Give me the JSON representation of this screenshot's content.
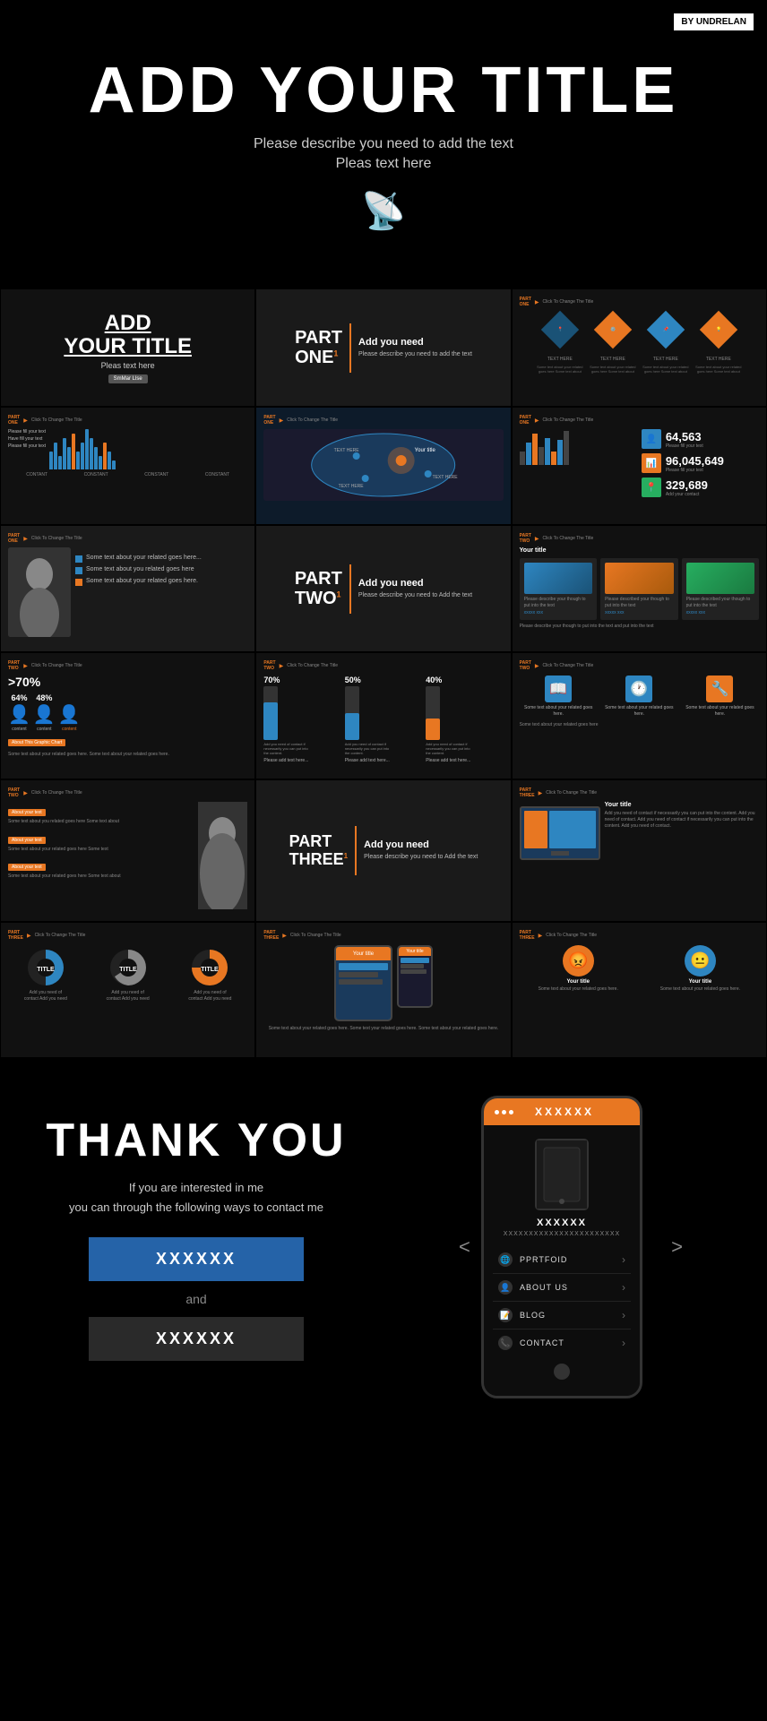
{
  "watermark": {
    "text": "BY UNDRELAN"
  },
  "hero": {
    "title": "ADD YOUR TITLE",
    "subtitle1": "Please describe you need to add the text",
    "subtitle2": "Pleas text here"
  },
  "slides": {
    "row1": [
      {
        "type": "title",
        "title_line1": "ADD",
        "title_line2": "YOUR TITLE",
        "subtitle": "Pleas text here",
        "button": "SmMar Llse"
      },
      {
        "type": "part-intro",
        "part": "PART",
        "number": "ONE",
        "superscript": "1",
        "add_text": "Add you need",
        "desc": "Please describe you need to add the text"
      },
      {
        "type": "diamonds",
        "part": "PART ONE",
        "click": "Click To Change The Title",
        "items": [
          {
            "label": "TEXT HERE",
            "color": "blue"
          },
          {
            "label": "TEXT HERE",
            "color": "orange"
          },
          {
            "label": "TEXT HERE",
            "color": "blue2"
          },
          {
            "label": "TEXT HERE",
            "color": "orange"
          }
        ]
      }
    ],
    "row2": [
      {
        "type": "waveform",
        "part": "PART ONE",
        "click": "Click To Change The Title",
        "labels": [
          "CONTANT",
          "CONSTANT",
          "CONSTANT",
          "CONSTANT"
        ]
      },
      {
        "type": "map",
        "part": "PART ONE",
        "click": "Click To Change The Title",
        "labels": [
          "TEXT HERE",
          "Your title",
          "TEXT HERE",
          "TEXT HERE"
        ]
      },
      {
        "type": "stats",
        "part": "PART ONE",
        "click": "Click To Change The Title",
        "stats": [
          {
            "number": "64,563",
            "label": "Please fill your text"
          },
          {
            "number": "96,045,649",
            "label": "Please fill your text"
          },
          {
            "number": "329,689",
            "label": "Add your contact"
          }
        ]
      }
    ],
    "row3": [
      {
        "type": "photo-bullets",
        "part": "PART ONE",
        "click": "Click To Change The Title",
        "bullets": [
          "Some text about your related goes here...",
          "Some text about you related goes here",
          "Some text about your related goes here."
        ]
      },
      {
        "type": "part-intro",
        "part": "PART",
        "number": "TWO",
        "superscript": "1",
        "add_text": "Add you need",
        "desc": "Please describe you need to Add the text"
      },
      {
        "type": "cards",
        "part": "PART TWO",
        "click": "Click To Change The Title",
        "title": "Your title",
        "cards": [
          {
            "text": "Please describe your though to put into the text",
            "link": "xxxxx xxx"
          },
          {
            "text": "Please described your though to put into the text",
            "link": "xxxxx xxx"
          },
          {
            "text": "Please described your though to put into the text",
            "link": "xxxxx xxx"
          }
        ]
      }
    ],
    "row4": [
      {
        "type": "people-chart",
        "part": "PART TWO",
        "click": "Click To Change The Title",
        "pct_main": ">70%",
        "items": [
          {
            "pct": "64%",
            "label": "content"
          },
          {
            "pct": "48%",
            "label": "content"
          },
          {
            "pct": "content",
            "label": "content"
          }
        ],
        "chart_badge": "About This Graphic Chart",
        "desc": "Some text about your related goes here. Some text about your related goes here."
      },
      {
        "type": "thermo",
        "part": "PART TWO",
        "click": "Click To Change The Title",
        "items": [
          {
            "pct": "70%",
            "value": 70,
            "text": "Add you need of contact if necessarily you can put into the content. Add you need of contact."
          },
          {
            "pct": "50%",
            "value": 50,
            "text": "Add you need of contact if necessarily you can put into the content. Add you need of contact."
          },
          {
            "pct": "40%",
            "value": 40,
            "text": "Add you need of contact if necessarily you can put into the content. Ask you need of contact."
          }
        ],
        "labels": [
          "Please add text here...",
          "Please add text here...",
          "Please add text here..."
        ]
      },
      {
        "type": "icon-cards",
        "part": "PART TWO",
        "click": "Click To Change The Title",
        "items": [
          {
            "icon": "📖",
            "label": "Some text about your related goes here.",
            "color": "blue"
          },
          {
            "icon": "🕐",
            "label": "Some text about your related goes here.",
            "color": "blue"
          },
          {
            "icon": "🔧",
            "label": "Some text about your related goes here.",
            "color": "orange"
          }
        ],
        "desc": "Some text about your related goes here"
      }
    ],
    "row5": [
      {
        "type": "callout-bullets",
        "part": "PART TWO",
        "click": "Click To Change The Title",
        "callouts": [
          "About your text",
          "About your text",
          "About your text"
        ],
        "desc": "Some text about your related goes here Some text Some text about your related goes here Some text about"
      },
      {
        "type": "part-intro",
        "part": "PART",
        "number": "THREE",
        "superscript": "1",
        "add_text": "Add you need",
        "desc": "Please describe you need to Add the text"
      },
      {
        "type": "monitor-bullets",
        "part": "PART THREE",
        "click": "Click To Change The Title",
        "title": "Your title",
        "desc": "Add you need of contact if necessarily you can put into the content. Add you need of contact. Add you need of contact if necessarily you can put into the content. Add you need of contact."
      }
    ],
    "row6": [
      {
        "type": "pie-charts",
        "part": "PART THREE",
        "click": "Click To Change The Title",
        "pies": [
          {
            "label": "TITLE",
            "pct": 60,
            "color": "#2e86c1"
          },
          {
            "label": "TITLE",
            "pct": 75,
            "color": "#888"
          },
          {
            "label": "TITLE",
            "pct": 85,
            "color": "#e87722"
          }
        ]
      },
      {
        "type": "device-slide",
        "part": "PART THREE",
        "click": "Click To Change The Title",
        "title": "Your title",
        "sub_title": "Your title"
      },
      {
        "type": "face-icons",
        "part": "PART THREE",
        "click": "Click To Change The Title",
        "items": [
          {
            "icon": "😡",
            "color": "orange",
            "title": "Your title",
            "desc": "Some text about your related goes here."
          },
          {
            "icon": "😐",
            "color": "blue",
            "title": "Your title",
            "desc": "Some text about your related goes here."
          }
        ]
      }
    ]
  },
  "thankyou": {
    "title": "THANK YOU",
    "line1": "If you are interested in me",
    "line2": "you can through the following ways to contact me",
    "btn1": "XXXXXX",
    "and_text": "and",
    "btn2": "XXXXXX"
  },
  "phone": {
    "header_dots": 3,
    "header_title": "XXXXXX",
    "nav_left": "<",
    "nav_right": ">",
    "content_title": "XXXXXX",
    "content_sub": "XXXXXXXXXXXXXXXXXXXXXXX",
    "menu_items": [
      {
        "icon": "🌐",
        "label": "PPRTFOID"
      },
      {
        "icon": "👤",
        "label": "ABOUT US"
      },
      {
        "icon": "📝",
        "label": "BLOG"
      },
      {
        "icon": "📞",
        "label": "CONTACT"
      }
    ]
  }
}
